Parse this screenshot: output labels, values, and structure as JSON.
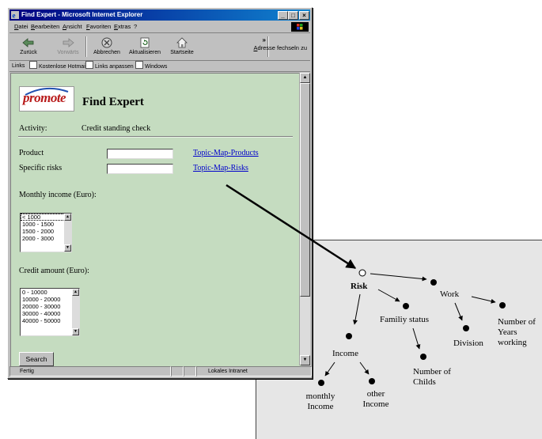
{
  "window": {
    "title": "Find Expert - Microsoft Internet Explorer",
    "minimize": "_",
    "maximize": "□",
    "close": "×"
  },
  "menu": [
    "Datei",
    "Bearbeiten",
    "Ansicht",
    "Favoriten",
    "Extras",
    "?"
  ],
  "toolbar": {
    "back": "Zurück",
    "forward": "Vorwärts",
    "stop": "Abbrechen",
    "refresh": "Aktualisieren",
    "home": "Startseite",
    "overflow": "»",
    "address_label": "Adresse fechseln zu"
  },
  "links_bar": {
    "label": "Links",
    "items": [
      "Kostenlose Hotmail",
      "Links anpassen",
      "Windows"
    ]
  },
  "page": {
    "logo": "promote",
    "title": "Find Expert",
    "activity_label": "Activity:",
    "activity_value": "Credit standing check",
    "product_label": "Product",
    "product_value": "",
    "product_link": "Topic-Map-Products",
    "risks_label": "Specific risks",
    "risks_value": "",
    "risks_link": "Topic-Map-Risks",
    "income_label": "Monthly income (Euro):",
    "income_options": [
      "< 1000",
      "1000 - 1500",
      "1500 - 2000",
      "2000 - 3000"
    ],
    "credit_label": "Credit amount (Euro):",
    "credit_options": [
      "0 - 10000",
      "10000 - 20000",
      "20000 - 30000",
      "30000 - 40000",
      "40000 - 50000"
    ],
    "search_button": "Search"
  },
  "status": {
    "text": "Fertig",
    "zone": "Lokales Intranet"
  },
  "topic_map": {
    "nodes": {
      "risk": "Risk",
      "work": "Work",
      "family": "Familiy status",
      "years": "Number of Years working",
      "division": "Division",
      "income": "Income",
      "childs": "Number of Childs",
      "monthly": "monthly Income",
      "other": "other Income"
    }
  }
}
